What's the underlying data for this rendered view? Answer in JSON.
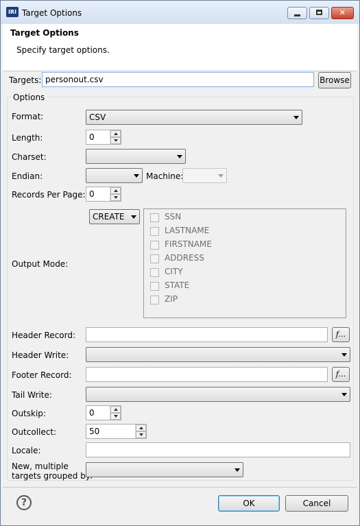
{
  "window": {
    "title": "Target Options",
    "app_icon": "IRI"
  },
  "header": {
    "title": "Target Options",
    "description": "Specify target options."
  },
  "targets": {
    "label": "Targets:",
    "value": "personout.csv",
    "browse_label": "Browse"
  },
  "options": {
    "group_title": "Options",
    "format": {
      "label": "Format:",
      "value": "CSV"
    },
    "length": {
      "label": "Length:",
      "value": "0"
    },
    "charset": {
      "label": "Charset:",
      "value": ""
    },
    "endian": {
      "label": "Endian:",
      "value": ""
    },
    "machine": {
      "label": "Machine:",
      "value": ""
    },
    "records_per_page": {
      "label": "Records Per Page:",
      "value": "0"
    },
    "output_mode": {
      "label": "Output Mode:",
      "value": "CREATE",
      "columns": [
        "SSN",
        "LASTNAME",
        "FIRSTNAME",
        "ADDRESS",
        "CITY",
        "STATE",
        "ZIP"
      ]
    },
    "header_record": {
      "label": "Header Record:",
      "value": "",
      "fn_label": "f..."
    },
    "header_write": {
      "label": "Header Write:",
      "value": ""
    },
    "footer_record": {
      "label": "Footer Record:",
      "value": "",
      "fn_label": "f..."
    },
    "tail_write": {
      "label": "Tail Write:",
      "value": ""
    },
    "outskip": {
      "label": "Outskip:",
      "value": "0"
    },
    "outcollect": {
      "label": "Outcollect:",
      "value": "50"
    },
    "locale": {
      "label": "Locale:",
      "value": ""
    },
    "grouped_by": {
      "label_line1": "New, multiple",
      "label_line2": "targets grouped by:",
      "value": ""
    }
  },
  "footer": {
    "help_glyph": "?",
    "ok_label": "OK",
    "cancel_label": "Cancel"
  },
  "icons": {
    "window_controls": [
      "minimize-icon",
      "maximize-icon",
      "close-icon"
    ]
  }
}
